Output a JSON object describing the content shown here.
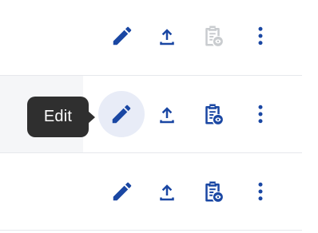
{
  "tooltip": {
    "text": "Edit"
  },
  "colors": {
    "accent": "#1a47a3",
    "disabled": "#c9cccf",
    "hover_bg": "#e8ecf7",
    "row_highlight": "#f5f6f8",
    "tooltip_bg": "#2f2f2f"
  },
  "rows": [
    {
      "actions": [
        {
          "icon": "pencil-icon",
          "action": "edit",
          "enabled": true
        },
        {
          "icon": "upload-icon",
          "action": "upload",
          "enabled": true
        },
        {
          "icon": "clipboard-view-icon",
          "action": "view",
          "enabled": false
        },
        {
          "icon": "more-vertical-icon",
          "action": "more",
          "enabled": true
        }
      ]
    },
    {
      "hovered_action": "edit",
      "actions": [
        {
          "icon": "pencil-icon",
          "action": "edit",
          "enabled": true
        },
        {
          "icon": "upload-icon",
          "action": "upload",
          "enabled": true
        },
        {
          "icon": "clipboard-view-icon",
          "action": "view",
          "enabled": true
        },
        {
          "icon": "more-vertical-icon",
          "action": "more",
          "enabled": true
        }
      ]
    },
    {
      "actions": [
        {
          "icon": "pencil-icon",
          "action": "edit",
          "enabled": true
        },
        {
          "icon": "upload-icon",
          "action": "upload",
          "enabled": true
        },
        {
          "icon": "clipboard-view-icon",
          "action": "view",
          "enabled": true
        },
        {
          "icon": "more-vertical-icon",
          "action": "more",
          "enabled": true
        }
      ]
    }
  ]
}
